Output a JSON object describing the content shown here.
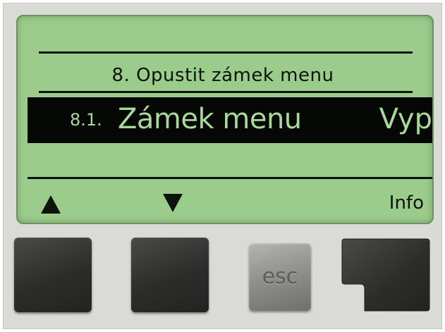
{
  "display": {
    "header_title": "8. Opustit zámek menu",
    "selected_item": {
      "number": "8.1.",
      "label": "Zámek menu",
      "value": "Vyp"
    },
    "softkeys": {
      "up_icon": "up-triangle-icon",
      "down_icon": "down-triangle-icon",
      "info_label": "Info"
    },
    "colors": {
      "lcd_background": "#9ccc8c",
      "lcd_ink": "#0b130a",
      "highlight_text": "#a8d89a"
    }
  },
  "buttons": {
    "esc_label": "esc"
  }
}
